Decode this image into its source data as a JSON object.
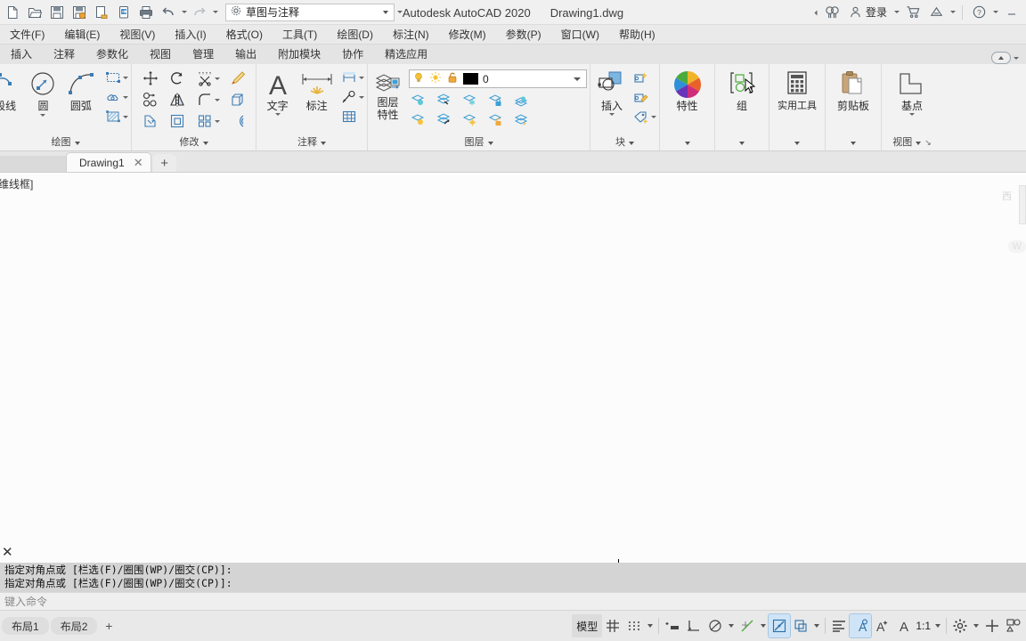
{
  "titlebar": {
    "quick_access": [
      {
        "name": "new-file-icon",
        "tip": "新建"
      },
      {
        "name": "open-file-icon",
        "tip": "打开"
      },
      {
        "name": "save-icon",
        "tip": "保存"
      },
      {
        "name": "save-as-icon",
        "tip": "另存为"
      },
      {
        "name": "export-icon",
        "tip": "输出"
      },
      {
        "name": "cloud-sync-icon",
        "tip": "同步"
      },
      {
        "name": "print-icon",
        "tip": "打印"
      },
      {
        "name": "undo-icon",
        "tip": "放弃"
      },
      {
        "name": "redo-icon",
        "tip": "重做"
      }
    ],
    "workspace": "草图与注释",
    "app_title": "Autodesk AutoCAD 2020",
    "document_name": "Drawing1.dwg",
    "search_placeholder": "",
    "signin_label": "登录",
    "help_label": "?"
  },
  "menubar": {
    "items": [
      "文件(F)",
      "编辑(E)",
      "视图(V)",
      "插入(I)",
      "格式(O)",
      "工具(T)",
      "绘图(D)",
      "标注(N)",
      "修改(M)",
      "参数(P)",
      "窗口(W)",
      "帮助(H)"
    ]
  },
  "ribbon_tabs": {
    "items": [
      "插入",
      "注释",
      "参数化",
      "视图",
      "管理",
      "输出",
      "附加模块",
      "协作",
      "精选应用"
    ]
  },
  "ribbon": {
    "panels": [
      {
        "name": "draw",
        "title": "绘图",
        "big_buttons": [
          {
            "label": "段线",
            "icon": "polyline-icon"
          },
          {
            "label": "圆",
            "icon": "circle-icon"
          },
          {
            "label": "圆弧",
            "icon": "arc-icon"
          }
        ],
        "small_buttons": [
          {
            "icon": "rectangle-icon"
          },
          {
            "icon": "revcloud-icon"
          },
          {
            "icon": "hatch-icon"
          }
        ]
      },
      {
        "name": "modify",
        "title": "修改",
        "small_buttons": [
          {
            "icon": "move-icon"
          },
          {
            "icon": "rotate-icon"
          },
          {
            "icon": "trim-icon"
          },
          {
            "icon": "erase-brush-icon"
          },
          {
            "icon": "copy-icon"
          },
          {
            "icon": "mirror-icon"
          },
          {
            "icon": "fillet-icon"
          },
          {
            "icon": "extrude-icon"
          },
          {
            "icon": "stretch-icon"
          },
          {
            "icon": "scale-icon"
          },
          {
            "icon": "array-icon"
          },
          {
            "icon": "offset-icon"
          }
        ]
      },
      {
        "name": "annotation",
        "title": "注释",
        "big_buttons": [
          {
            "label": "文字",
            "icon": "text-icon"
          },
          {
            "label": "标注",
            "icon": "dimension-icon"
          }
        ],
        "small_buttons": [
          {
            "icon": "dim-linear-icon"
          },
          {
            "icon": "leader-icon"
          },
          {
            "icon": "table-icon"
          }
        ]
      },
      {
        "name": "layers",
        "title": "图层",
        "big_label_line1": "图层",
        "big_label_line2": "特性",
        "layer_combo": {
          "on_icon": "lightbulb-icon",
          "freeze_icon": "sun-icon",
          "lock_icon": "unlock-icon",
          "color": "#000000",
          "value": "0"
        },
        "small_buttons": [
          {
            "icon": "layer-isolate-icon"
          },
          {
            "icon": "layer-off-icon"
          },
          {
            "icon": "layer-freeze-icon"
          },
          {
            "icon": "layer-lock-icon"
          },
          {
            "icon": "layer-make-current-icon"
          },
          {
            "icon": "layer-unisolate-icon"
          },
          {
            "icon": "layer-turn-on-icon"
          },
          {
            "icon": "layer-thaw-icon"
          },
          {
            "icon": "layer-unlock-icon"
          },
          {
            "icon": "layer-match-icon"
          }
        ]
      },
      {
        "name": "blocks",
        "title": "块",
        "big_buttons": [
          {
            "label": "插入",
            "icon": "insert-block-icon"
          }
        ],
        "small_buttons": [
          {
            "icon": "create-block-icon"
          },
          {
            "icon": "edit-block-icon"
          },
          {
            "icon": "define-attribute-icon"
          }
        ]
      },
      {
        "name": "properties",
        "title": "",
        "big_buttons": [
          {
            "label": "特性",
            "icon": "properties-wheel-icon"
          }
        ]
      },
      {
        "name": "groups",
        "title": "",
        "big_buttons": [
          {
            "label": "组",
            "icon": "group-icon"
          }
        ]
      },
      {
        "name": "utilities",
        "title": "",
        "big_buttons": [
          {
            "label": "实用工具",
            "icon": "calculator-icon"
          }
        ]
      },
      {
        "name": "clipboard",
        "title": "",
        "big_buttons": [
          {
            "label": "剪贴板",
            "icon": "clipboard-icon"
          }
        ]
      },
      {
        "name": "view",
        "title": "视图",
        "big_buttons": [
          {
            "label": "基点",
            "icon": "base-point-icon"
          }
        ]
      }
    ]
  },
  "doctabs": {
    "tabs": [
      {
        "label": "Drawing1",
        "close": "✕"
      }
    ],
    "new_tab": "+"
  },
  "canvas": {
    "viewport_label": "二维线框]",
    "circle_color": "#fbf10a",
    "background": "#fcfcfc",
    "viewcube_label": "西",
    "wcs_label": "W"
  },
  "command_line": {
    "close": "✕",
    "history": [
      "指定对角点或 [栏选(F)/圈围(WP)/圈交(CP)]:",
      "指定对角点或 [栏选(F)/圈围(WP)/圈交(CP)]:"
    ],
    "prompt_placeholder": "键入命令"
  },
  "statusbar": {
    "layout_tabs": [
      "布局1",
      "布局2"
    ],
    "add_layout": "+",
    "model_label": "模型",
    "scale": "1:1",
    "toggles": [
      {
        "name": "grid-display-icon",
        "on": false
      },
      {
        "name": "snap-mode-icon",
        "on": false
      },
      {
        "name": "ortho-mode-icon",
        "on": false
      },
      {
        "name": "polar-tracking-icon",
        "on": false
      },
      {
        "name": "object-snap-icon",
        "on": false
      },
      {
        "name": "object-snap-tracking-icon",
        "on": true
      },
      {
        "name": "lineweight-icon",
        "on": false
      },
      {
        "name": "transparency-icon",
        "on": false
      },
      {
        "name": "selection-cycling-icon",
        "on": false
      },
      {
        "name": "annotation-visibility-icon",
        "on": true
      },
      {
        "name": "autoscale-icon",
        "on": false
      },
      {
        "name": "annotation-scale-icon",
        "on": false
      },
      {
        "name": "workspace-switch-icon",
        "on": false
      },
      {
        "name": "customization-icon",
        "on": false
      },
      {
        "name": "isolate-objects-icon",
        "on": false
      }
    ]
  }
}
